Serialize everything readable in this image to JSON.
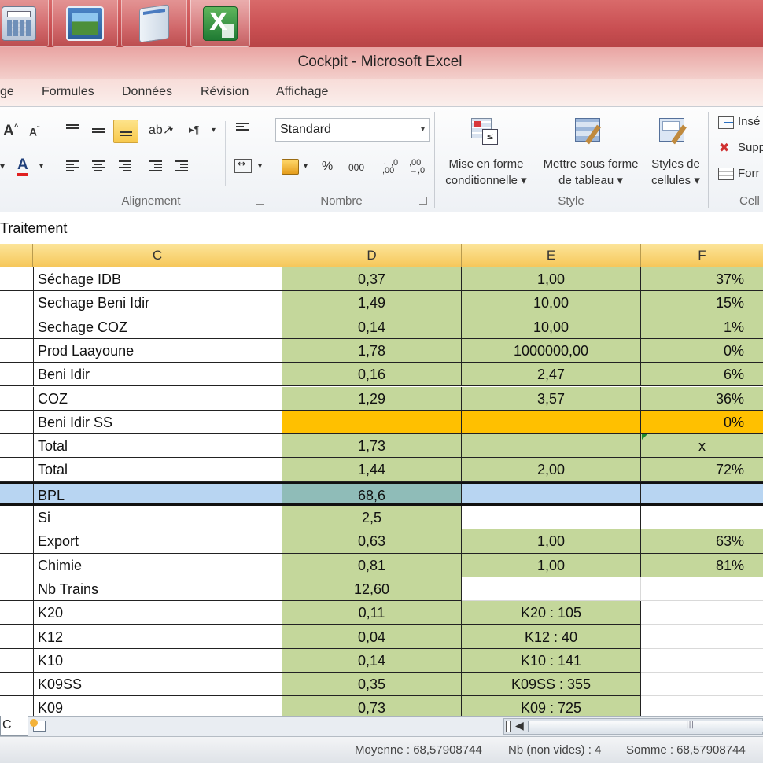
{
  "taskbar": {
    "apps": [
      {
        "icon": "calculator-icon"
      },
      {
        "icon": "photo-viewer-icon"
      },
      {
        "icon": "notepad-icon"
      },
      {
        "icon": "excel-icon"
      }
    ]
  },
  "window": {
    "title": "Cockpit - Microsoft Excel"
  },
  "ribbon": {
    "tabs": [
      "ge",
      "Formules",
      "Données",
      "Révision",
      "Affichage"
    ],
    "groups": {
      "alignment": "Alignement",
      "number": "Nombre",
      "style": "Style",
      "cells": "Cell"
    },
    "number_format": "Standard",
    "percent_label": "%",
    "thousands_label": "000",
    "style_buttons": {
      "conditional": [
        "Mise en forme",
        "conditionnelle ▾"
      ],
      "table": [
        "Mettre sous forme",
        "de tableau ▾"
      ],
      "cell_styles": [
        "Styles de",
        "cellules ▾"
      ]
    },
    "cells_buttons": [
      "Insé",
      "Supp",
      "Forr"
    ]
  },
  "formula_bar": {
    "content": "Traitement"
  },
  "columns": [
    "C",
    "D",
    "E",
    "F"
  ],
  "rows": [
    {
      "c": "Séchage IDB",
      "d": "0,37",
      "e": "1,00",
      "f": "37%",
      "fill": "green"
    },
    {
      "c": "Sechage Beni Idir",
      "d": "1,49",
      "e": "10,00",
      "f": "15%",
      "fill": "green"
    },
    {
      "c": "Sechage COZ",
      "d": "0,14",
      "e": "10,00",
      "f": "1%",
      "fill": "green"
    },
    {
      "c": "Prod Laayoune",
      "d": "1,78",
      "e": "1000000,00",
      "f": "0%",
      "fill": "green"
    },
    {
      "c": "Beni Idir",
      "d": "0,16",
      "e": "2,47",
      "f": "6%",
      "fill": "green"
    },
    {
      "c": "COZ",
      "d": "1,29",
      "e": "3,57",
      "f": "36%",
      "fill": "green"
    },
    {
      "c": "Beni Idir SS",
      "d": "",
      "e": "",
      "f": "0%",
      "fill": "orange"
    },
    {
      "c": "Total",
      "d": "1,73",
      "e": "",
      "f": "x",
      "fill": "green"
    },
    {
      "c": "Total",
      "d": "1,44",
      "e": "2,00",
      "f": "72%",
      "fill": "green"
    },
    {
      "c": "BPL",
      "d": "68,6",
      "e": "",
      "f": "",
      "fill": "blue"
    },
    {
      "c": "Si",
      "d": "2,5",
      "e": "",
      "f": "",
      "fill": "si"
    },
    {
      "c": "Export",
      "d": "0,63",
      "e": "1,00",
      "f": "63%",
      "fill": "green"
    },
    {
      "c": "Chimie",
      "d": "0,81",
      "e": "1,00",
      "f": "81%",
      "fill": "green"
    },
    {
      "c": "Nb Trains",
      "d": "12,60",
      "e": "",
      "f": "",
      "fill": "nb"
    },
    {
      "c": "K20",
      "d": "0,11",
      "e": "K20 : 105",
      "f": "",
      "fill": "k"
    },
    {
      "c": "K12",
      "d": "0,04",
      "e": "K12 : 40",
      "f": "",
      "fill": "k"
    },
    {
      "c": "K10",
      "d": "0,14",
      "e": "K10 : 141",
      "f": "",
      "fill": "k"
    },
    {
      "c": "K09SS",
      "d": "0,35",
      "e": "K09SS : 355",
      "f": "",
      "fill": "k"
    },
    {
      "c": "K09",
      "d": "0,73",
      "e": "K09 : 725",
      "f": "",
      "fill": "k"
    }
  ],
  "sheet_tab": "C",
  "status": {
    "average": "Moyenne : 68,57908744",
    "count": "Nb (non vides) : 4",
    "sum": "Somme : 68,57908744"
  },
  "colors": {
    "green_fill": "#c4d79b",
    "orange_fill": "#ffc000",
    "selected_row": "#b8d5f2",
    "header": "#f6c75a",
    "taskbar": "#c94f52"
  }
}
